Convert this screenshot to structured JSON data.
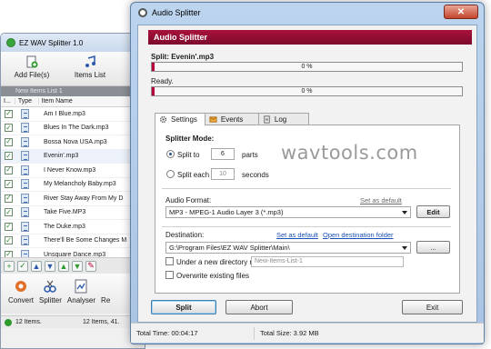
{
  "bg_window": {
    "title": "EZ WAV Splitter 1.0",
    "toolbar": {
      "add_files": "Add File(s)",
      "items_list": "Items List"
    },
    "list_caption": "New Items List 1",
    "columns": [
      "I...",
      "Type",
      "Item Name"
    ],
    "rows": [
      {
        "name": "Am I Blue.mp3",
        "checked": true
      },
      {
        "name": "Blues In The Dark.mp3",
        "checked": true
      },
      {
        "name": "Bossa Nova USA.mp3",
        "checked": true
      },
      {
        "name": "Evenin'.mp3",
        "checked": true
      },
      {
        "name": "I Never Know.mp3",
        "checked": true
      },
      {
        "name": "My Melancholy Baby.mp3",
        "checked": true
      },
      {
        "name": "River Stay Away From My D",
        "checked": true
      },
      {
        "name": "Take Five.MP3",
        "checked": true
      },
      {
        "name": "The Duke.mp3",
        "checked": true
      },
      {
        "name": "There'll Be Some Changes M",
        "checked": true
      },
      {
        "name": "Unsquare Dance.mp3",
        "checked": true
      }
    ],
    "actions": {
      "convert": "Convert",
      "splitter": "Splitter",
      "analyser": "Analyser",
      "more": "Re"
    },
    "status": {
      "items": "12 Items.",
      "items_detail": "12 Items, 41."
    }
  },
  "dialog": {
    "title": "Audio Splitter",
    "close_glyph": "✕",
    "banner": "Audio Splitter",
    "split_label": "Split: Evenin'.mp3",
    "progress1": {
      "text": "0 %",
      "value": 0
    },
    "ready_label": "Ready.",
    "progress2": {
      "text": "0 %",
      "value": 0
    },
    "tabs": [
      "Settings",
      "Events",
      "Log"
    ],
    "splitter_mode": "Splitter Mode:",
    "split_to": {
      "label": "Split to",
      "value": "6",
      "unit": "parts"
    },
    "split_each": {
      "label": "Split each",
      "value": "10",
      "unit": "seconds"
    },
    "audio_format": {
      "label": "Audio Format:",
      "set_default": "Set as default",
      "value": "MP3 - MPEG-1 Audio Layer 3 (*.mp3)",
      "edit": "Edit"
    },
    "destination": {
      "label": "Destination:",
      "set_default": "Set as default",
      "open_folder": "Open destination folder",
      "value": "G:\\Program Files\\EZ WAV Splitter\\Main\\",
      "browse": "...",
      "under_new_dir": "Under a new directory name:",
      "new_dir_placeholder": "New-Items-List-1",
      "overwrite": "Overwrite existing files"
    },
    "buttons": {
      "split": "Split",
      "abort": "Abort",
      "exit": "Exit"
    },
    "status": {
      "total_time": "Total Time: 00:04:17",
      "total_size": "Total Size: 3.92 MB"
    }
  },
  "watermark": "wavtools.com",
  "colors": {
    "banner": "#8c0e33",
    "progress_fill": "#b8003a",
    "link": "#1a4fb8"
  }
}
